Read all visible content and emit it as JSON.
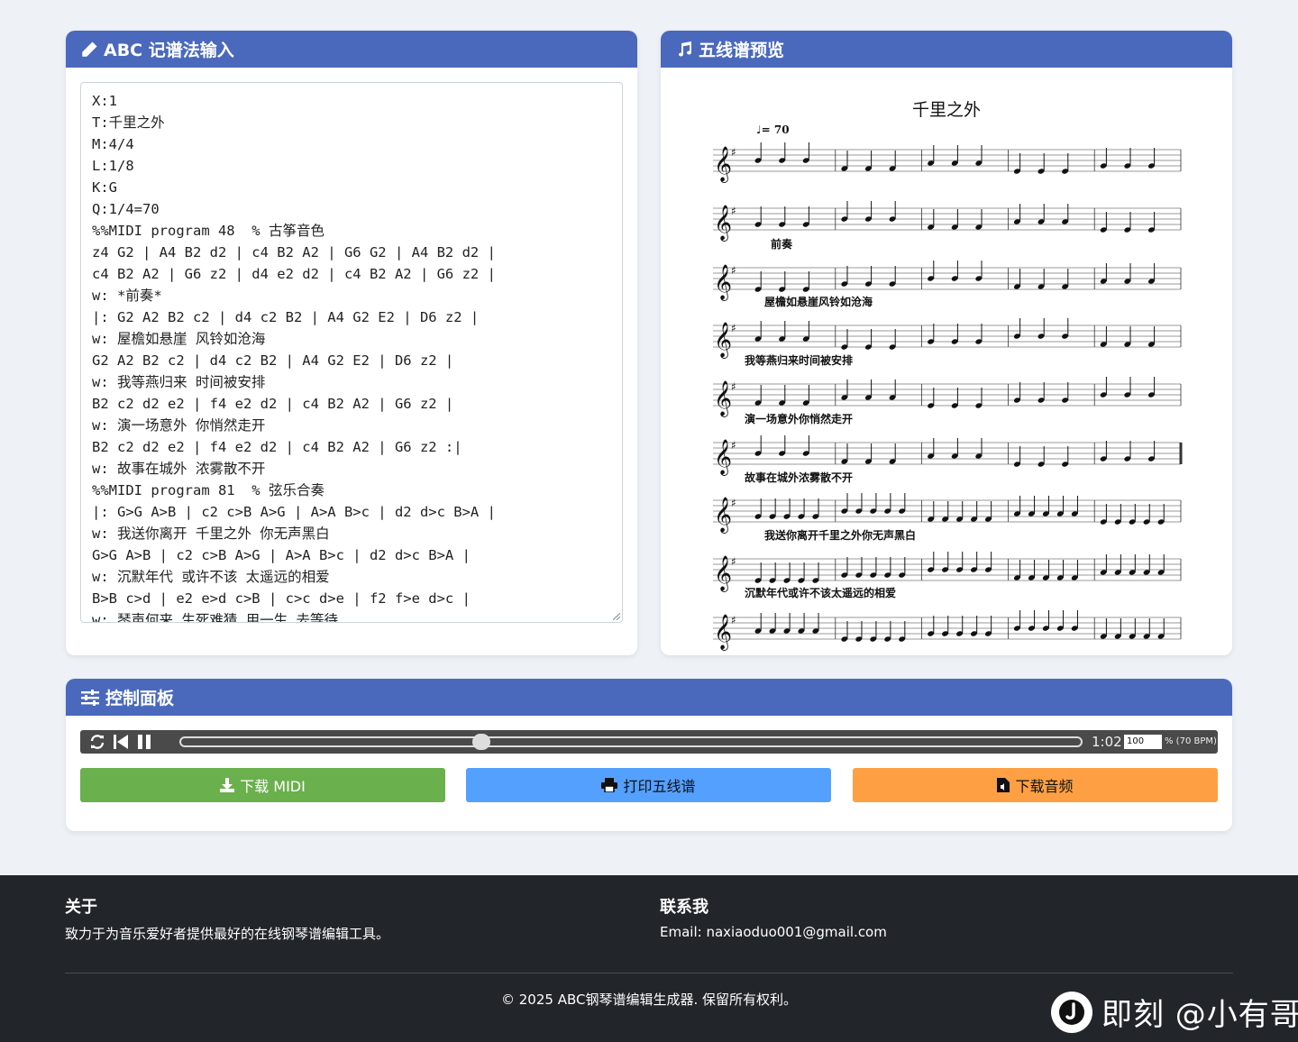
{
  "editor": {
    "title": "ABC 记谱法输入",
    "lines": [
      "X:1",
      "T:千里之外",
      "M:4/4",
      "L:1/8",
      "K:G",
      "Q:1/4=70",
      "%%MIDI program 48  % 古筝音色",
      "z4 G2 | A4 B2 d2 | c4 B2 A2 | G6 G2 | A4 B2 d2 |",
      "c4 B2 A2 | G6 z2 | d4 e2 d2 | c4 B2 A2 | G6 z2 |",
      "w: *前奏*",
      "|: G2 A2 B2 c2 | d4 c2 B2 | A4 G2 E2 | D6 z2 |",
      "w: 屋檐如悬崖 风铃如沧海",
      "G2 A2 B2 c2 | d4 c2 B2 | A4 G2 E2 | D6 z2 |",
      "w: 我等燕归来 时间被安排",
      "B2 c2 d2 e2 | f4 e2 d2 | c4 B2 A2 | G6 z2 |",
      "w: 演一场意外 你悄然走开",
      "B2 c2 d2 e2 | f4 e2 d2 | c4 B2 A2 | G6 z2 :|",
      "w: 故事在城外 浓雾散不开",
      "%%MIDI program 81  % 弦乐合奏",
      "|: G>G A>B | c2 c>B A>G | A>A B>c | d2 d>c B>A |",
      "w: 我送你离开 千里之外 你无声黑白",
      "G>G A>B | c2 c>B A>G | A>A B>c | d2 d>c B>A |",
      "w: 沉默年代 或许不该 太遥远的相爱",
      "B>B c>d | e2 e>d c>B | c>c d>e | f2 f>e d>c |",
      "w: 琴声何来 生死难猜 用一生 去等待"
    ]
  },
  "preview": {
    "title": "五线谱预览",
    "score_title": "千里之外",
    "tempo_text": "= 70",
    "lyrics": [
      "前奏",
      "屋檐如悬崖风铃如沧海",
      "我等燕归来时间被安排",
      "演一场意外你悄然走开",
      "故事在城外浓雾散不开",
      "我送你离开千里之外你无声黑白",
      "沉默年代或许不该太遥远的相爱"
    ]
  },
  "controls": {
    "title": "控制面板",
    "time": "1:02",
    "tempo_percent": "100",
    "bpm_text": "% (70 BPM)",
    "progress": 0.33,
    "download_midi": "下载 MIDI",
    "print_score": "打印五线谱",
    "download_audio": "下载音频",
    "colors": {
      "header": "#4a69bd",
      "midi": "#6ab04c",
      "print": "#54a0ff",
      "audio": "#ff9f43"
    }
  },
  "footer": {
    "about_title": "关于",
    "about_text": "致力于为音乐爱好者提供最好的在线钢琴谱编辑工具。",
    "contact_title": "联系我",
    "contact_text": "Email: naxiaoduo001@gmail.com",
    "copyright": "© 2025 ABC钢琴谱编辑生成器. 保留所有权利。"
  },
  "watermark": {
    "text": "即刻 @小有哥"
  }
}
